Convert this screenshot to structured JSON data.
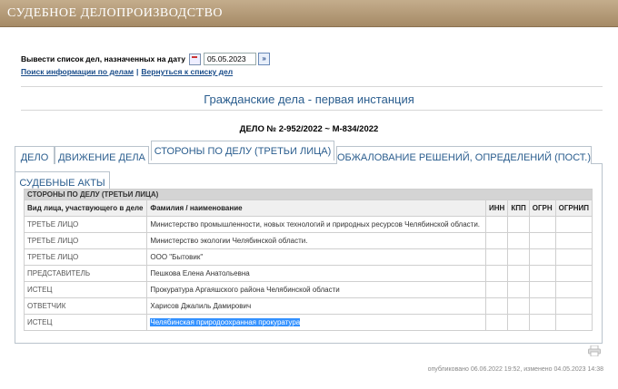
{
  "header": {
    "title": "СУДЕБНОЕ ДЕЛОПРОИЗВОДСТВО"
  },
  "datebar": {
    "label": "Вывести список дел, назначенных на дату",
    "date": "05.05.2023",
    "go": "»"
  },
  "links": {
    "search": "Поиск информации по делам",
    "separator": "|",
    "back": "Вернуться к списку дел"
  },
  "heading": "Гражданские дела - первая инстанция",
  "case_number": "ДЕЛО № 2-952/2022 ~ М-834/2022",
  "tabs": [
    {
      "label": "ДЕЛО"
    },
    {
      "label": "ДВИЖЕНИЕ ДЕЛА"
    },
    {
      "label": "СТОРОНЫ ПО ДЕЛУ (ТРЕТЬИ ЛИЦА)"
    },
    {
      "label": "ОБЖАЛОВАНИЕ РЕШЕНИЙ, ОПРЕДЕЛЕНИЙ (ПОСТ.)"
    },
    {
      "label": "СУДЕБНЫЕ АКТЫ"
    }
  ],
  "table": {
    "caption": "СТОРОНЫ ПО ДЕЛУ (ТРЕТЬИ ЛИЦА)",
    "columns": [
      "Вид лица, участвующего в деле",
      "Фамилия / наименование",
      "ИНН",
      "КПП",
      "ОГРН",
      "ОГРНИП"
    ],
    "rows": [
      [
        "ТРЕТЬЕ ЛИЦО",
        "Министерство промышленности, новых технологий и природных ресурсов Челябинской области.",
        "",
        "",
        "",
        ""
      ],
      [
        "ТРЕТЬЕ ЛИЦО",
        "Министерство экологии Челябинской области.",
        "",
        "",
        "",
        ""
      ],
      [
        "ТРЕТЬЕ ЛИЦО",
        "ООО \"Бытовик\"",
        "",
        "",
        "",
        ""
      ],
      [
        "ПРЕДСТАВИТЕЛЬ",
        "Пешкова Елена Анатольевна",
        "",
        "",
        "",
        ""
      ],
      [
        "ИСТЕЦ",
        "Прокуратура Аргаяшского района Челябинской области",
        "",
        "",
        "",
        ""
      ],
      [
        "ОТВЕТЧИК",
        "Харисов Джалиль Дамирович",
        "",
        "",
        "",
        ""
      ],
      [
        "ИСТЕЦ",
        "Челябинская природоохранная прокуратура",
        "",
        "",
        "",
        ""
      ]
    ]
  },
  "footer": "опубликовано 06.06.2022 19:52, изменено 04.05.2023 14:38",
  "icons": {
    "calendar": "calendar-icon",
    "print": "print-icon"
  }
}
